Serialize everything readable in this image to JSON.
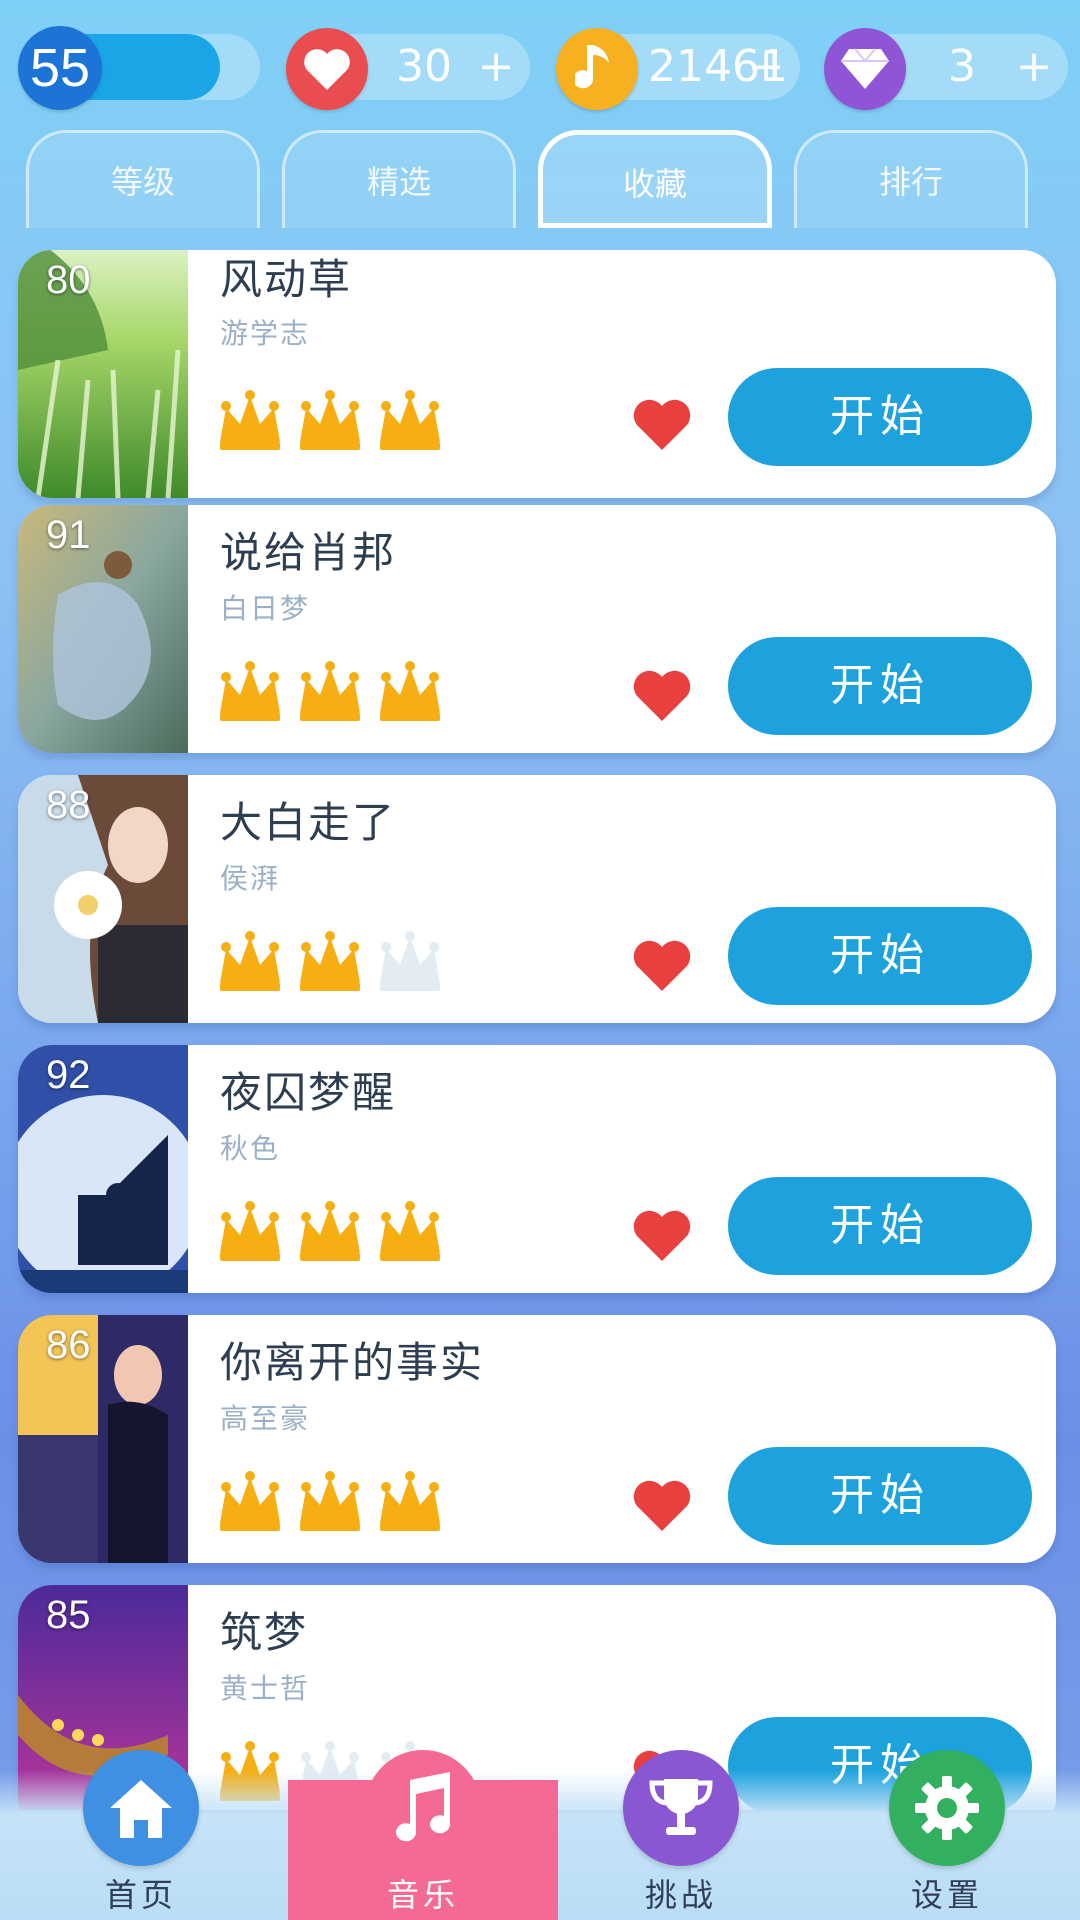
{
  "status": {
    "level": "55",
    "level_progress": 0.78,
    "hearts": "30",
    "notes": "21461",
    "gems": "3",
    "plus": "+"
  },
  "tabs": [
    {
      "label": "等级",
      "active": false
    },
    {
      "label": "精选",
      "active": false
    },
    {
      "label": "收藏",
      "active": true
    },
    {
      "label": "排行",
      "active": false
    }
  ],
  "songs": [
    {
      "num": "80",
      "title": "风动草",
      "artist": "游学志",
      "crowns": 3,
      "favorite": true,
      "button": "开始"
    },
    {
      "num": "91",
      "title": "说给肖邦",
      "artist": "白日梦",
      "crowns": 3,
      "favorite": true,
      "button": "开始"
    },
    {
      "num": "88",
      "title": "大白走了",
      "artist": "侯湃",
      "crowns": 2,
      "favorite": true,
      "button": "开始"
    },
    {
      "num": "92",
      "title": "夜囚梦醒",
      "artist": "秋色",
      "crowns": 3,
      "favorite": true,
      "button": "开始"
    },
    {
      "num": "86",
      "title": "你离开的事实",
      "artist": "高至豪",
      "crowns": 3,
      "favorite": true,
      "button": "开始"
    },
    {
      "num": "85",
      "title": "筑梦",
      "artist": "黄士哲",
      "crowns": 1,
      "favorite": true,
      "button": "开始"
    }
  ],
  "nav": {
    "home": "首页",
    "music": "音乐",
    "challenge": "挑战",
    "settings": "设置"
  },
  "colors": {
    "accent_blue": "#1ea2de",
    "crown_gold": "#f6ae12",
    "crown_empty": "#e3ebf3",
    "heart_red": "#e8403e",
    "music_pink": "#f56995"
  }
}
